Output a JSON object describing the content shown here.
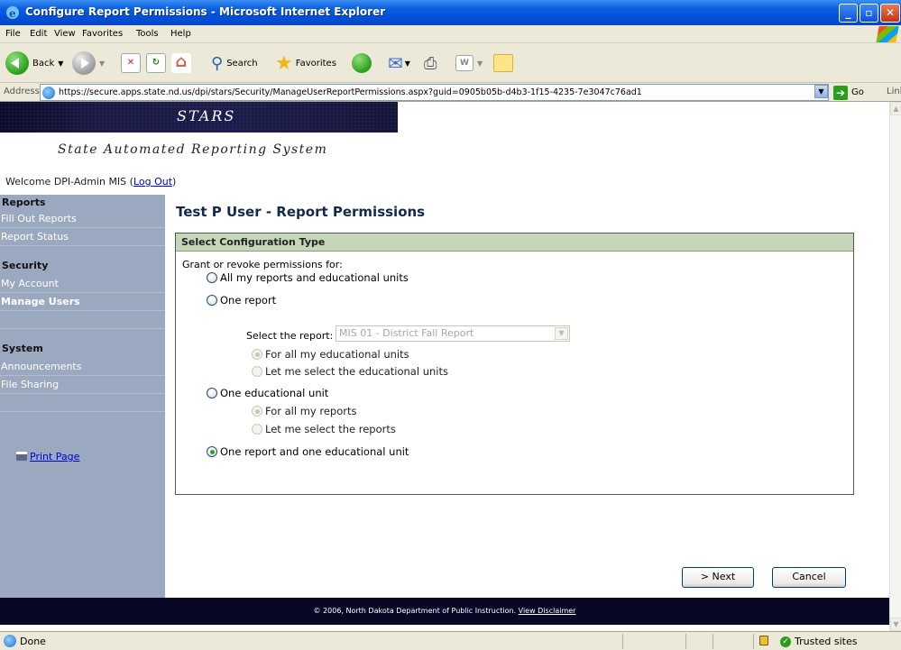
{
  "window": {
    "title": "Configure Report Permissions - Microsoft Internet Explorer",
    "min": "_",
    "max": "▫",
    "close": "✕"
  },
  "menu": [
    "File",
    "Edit",
    "View",
    "Favorites",
    "Tools",
    "Help"
  ],
  "toolbar": {
    "back_label": "Back",
    "search_label": "Search",
    "favorites_label": "Favorites"
  },
  "address": {
    "label": "Address",
    "url": "https://secure.apps.state.nd.us/dpi/stars/Security/ManageUserReportPermissions.aspx?guid=0905b05b-d4b3-1f15-4235-7e3047c76ad1",
    "go_label": "Go",
    "links_label": "Links"
  },
  "banner": {
    "title": "STARS",
    "subtitle": "State Automated Reporting System"
  },
  "welcome": {
    "text": "Welcome DPI-Admin MIS (",
    "logout": "Log Out",
    "close_paren": ")"
  },
  "sidebar": {
    "reports_header": "Reports",
    "fill_out": "Fill Out Reports",
    "report_status": "Report Status",
    "security_header": "Security",
    "my_account": "My Account",
    "manage_users": "Manage Users",
    "system_header": "System",
    "announcements": "Announcements",
    "file_sharing": "File Sharing",
    "print_page": "Print Page"
  },
  "main": {
    "heading": "Test P User - Report Permissions",
    "panel_title": "Select Configuration Type",
    "intro": "Grant or revoke permissions for:",
    "opt_all": "All my reports and educational units",
    "opt_one_report": "One report",
    "select_label": "Select the report:",
    "select_value": "MIS 01 - District Fall Report",
    "sub_all_units": "For all my educational units",
    "sub_select_units": "Let me select the educational units",
    "opt_one_unit": "One educational unit",
    "sub_all_reports": "For all my reports",
    "sub_select_reports": "Let me select the reports",
    "opt_report_and_unit": "One report and one educational unit",
    "next_label": "> Next",
    "cancel_label": "Cancel"
  },
  "footer": {
    "text": "© 2006, North Dakota Department of Public Instruction. ",
    "disclaimer": "View Disclaimer"
  },
  "status": {
    "done": "Done",
    "zone": "Trusted sites"
  }
}
